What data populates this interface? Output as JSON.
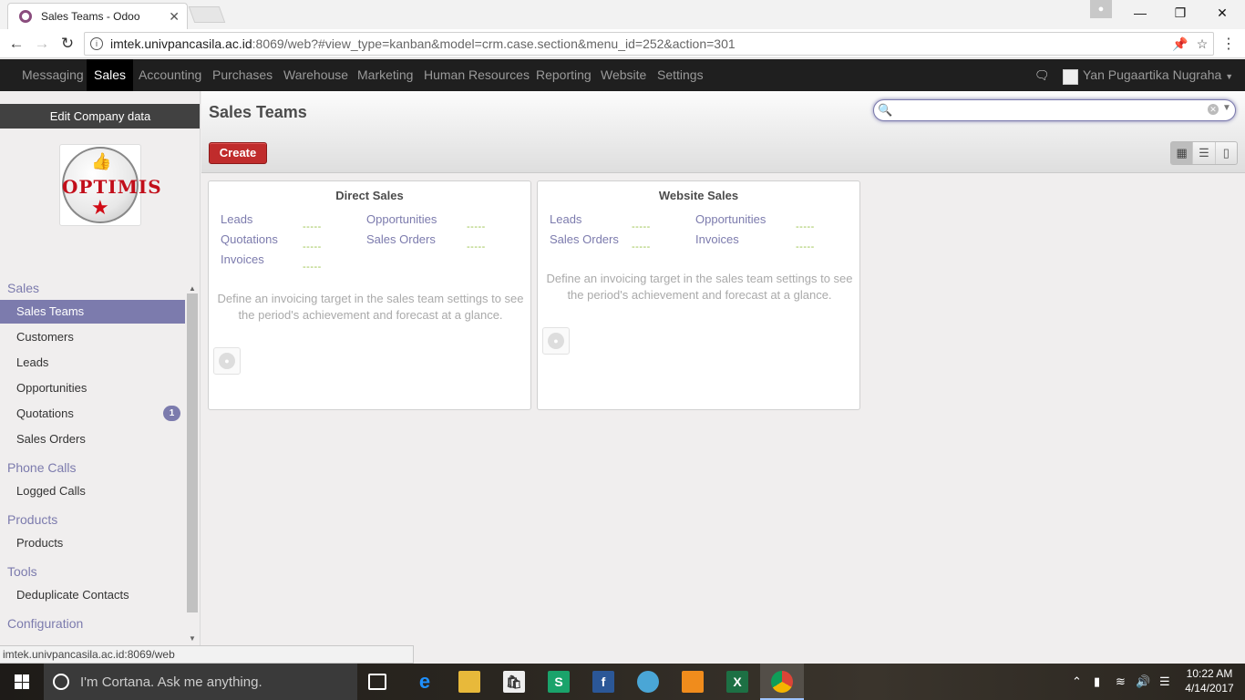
{
  "browser": {
    "tab_title": "Sales Teams - Odoo",
    "tab_close": "✕",
    "url_host": "imtek.univpancasila.ac.id",
    "url_rest": ":8069/web?#view_type=kanban&model=crm.case.section&menu_id=252&action=301",
    "status_url": "imtek.univpancasila.ac.id:8069/web"
  },
  "topnav": {
    "items": [
      "Messaging",
      "Sales",
      "Accounting",
      "Purchases",
      "Warehouse",
      "Marketing",
      "Human Resources",
      "Reporting",
      "Website",
      "Settings"
    ],
    "active": "Sales",
    "user_name": "Yan Pugaartika Nugraha"
  },
  "sidebar": {
    "edit_company": "Edit Company data",
    "logo_text": "OPTIMIS",
    "sections": [
      {
        "title": "Sales",
        "items": [
          "Sales Teams",
          "Customers",
          "Leads",
          "Opportunities",
          "Quotations",
          "Sales Orders"
        ]
      },
      {
        "title": "Phone Calls",
        "items": [
          "Logged Calls"
        ]
      },
      {
        "title": "Products",
        "items": [
          "Products"
        ]
      },
      {
        "title": "Tools",
        "items": [
          "Deduplicate Contacts"
        ]
      },
      {
        "title": "Configuration",
        "items": []
      }
    ],
    "active_item": "Sales Teams",
    "quotations_badge": "1"
  },
  "main": {
    "title": "Sales Teams",
    "search_value": "",
    "create_label": "Create",
    "view_modes": [
      "kanban",
      "list",
      "form"
    ],
    "active_view": "kanban",
    "cards": [
      {
        "title": "Direct Sales",
        "links": [
          "Leads",
          "Opportunities",
          "Quotations",
          "Sales Orders",
          "Invoices"
        ],
        "dash": "-----",
        "note": "Define an invoicing target in the sales team settings to see the period's achievement and forecast at a glance."
      },
      {
        "title": "Website Sales",
        "links": [
          "Leads",
          "Opportunities",
          "Sales Orders",
          "Invoices"
        ],
        "dash": "-----",
        "note": "Define an invoicing target in the sales team settings to see the period's achievement and forecast at a glance."
      }
    ]
  },
  "taskbar": {
    "cortana_text": "I'm Cortana. Ask me anything.",
    "time": "10:22 AM",
    "date": "4/14/2017"
  },
  "colors": {
    "accent": "#7c7bad",
    "create_button": "#c02c2c",
    "dash_green": "#9ac14a"
  }
}
